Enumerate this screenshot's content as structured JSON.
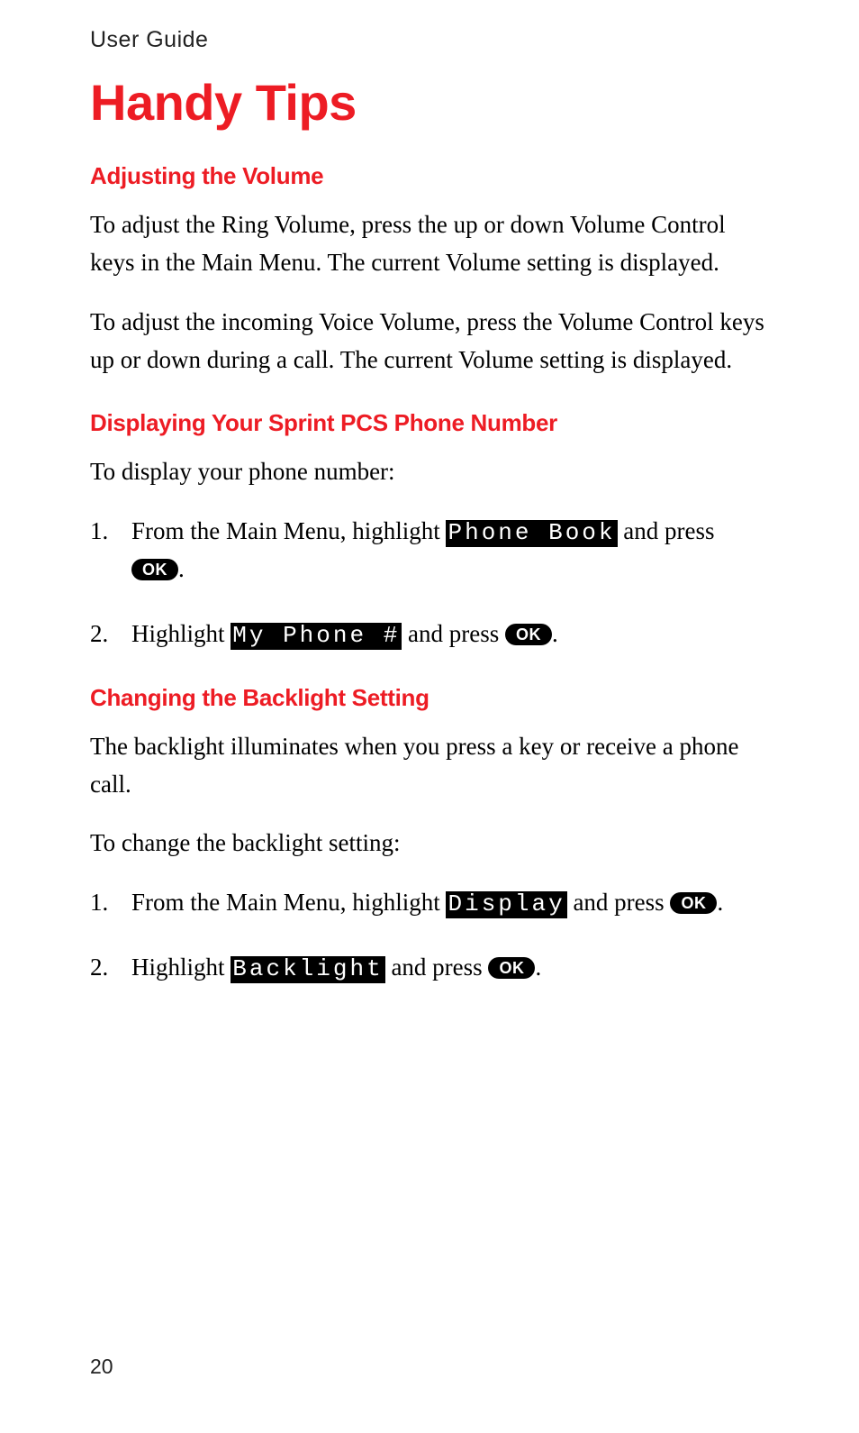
{
  "header": "User Guide",
  "title": "Handy Tips",
  "page_number": "20",
  "ok_label": "OK",
  "sections": {
    "volume": {
      "heading": "Adjusting the Volume",
      "p1": "To adjust the Ring Volume, press the up or down Volume Control keys in the Main Menu. The current Volume setting is displayed.",
      "p2": "To adjust the incoming Voice Volume, press the Volume Control keys up or down during a call. The current Volume setting is displayed."
    },
    "phone_number": {
      "heading": "Displaying Your Sprint PCS Phone Number",
      "intro": "To display your phone number:",
      "step1_num": "1.",
      "step1_a": "From the Main Menu, highlight ",
      "step1_token": "Phone Book",
      "step1_b": " and press ",
      "step1_c": ".",
      "step2_num": "2.",
      "step2_a": "Highlight ",
      "step2_token": "My Phone #",
      "step2_b": " and press ",
      "step2_c": "."
    },
    "backlight": {
      "heading": "Changing the Backlight Setting",
      "p1": "The backlight illuminates when you press a key or receive a phone call.",
      "intro": "To change the backlight setting:",
      "step1_num": "1.",
      "step1_a": "From the Main Menu, highlight ",
      "step1_token": "Display",
      "step1_b": " and press ",
      "step1_c": ".",
      "step2_num": "2.",
      "step2_a": "Highlight ",
      "step2_token": "Backlight",
      "step2_b": " and press ",
      "step2_c": "."
    }
  }
}
